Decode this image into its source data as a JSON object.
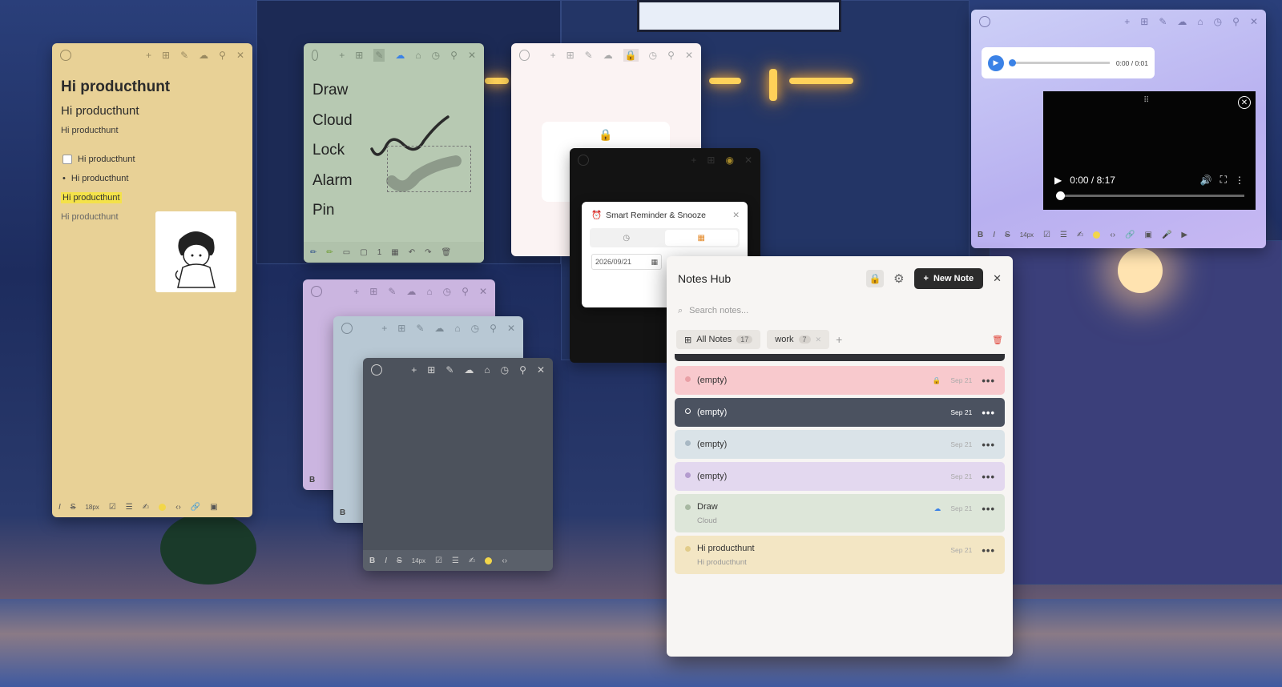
{
  "yellow_note": {
    "heading1": "Hi producthunt",
    "heading2": "Hi producthunt",
    "paragraph": "Hi producthunt",
    "checkbox_item": "Hi producthunt",
    "bullet_item": "Hi producthunt",
    "highlighted_text": "Hi producthunt",
    "plain_text": "Hi producthunt",
    "font_size": "18px",
    "footer_italic": "I",
    "footer_strike": "S"
  },
  "green_note": {
    "words": [
      "Draw",
      "Cloud",
      "Lock",
      "Alarm",
      "Pin"
    ],
    "page_count": "1"
  },
  "reminder": {
    "title": "Smart Reminder & Snooze",
    "date": "2026/09/21"
  },
  "purple_note": {
    "footer_bold": "B"
  },
  "bluegray_note": {
    "footer_bold": "B"
  },
  "dark_note": {
    "font_size": "14px",
    "bold": "B",
    "italic": "I",
    "strike": "S"
  },
  "media": {
    "audio_time": "0:00 / 0:01",
    "video_time": "0:00 / 8:17",
    "font_size": "14px",
    "bold": "B",
    "italic": "I",
    "strike": "S"
  },
  "hub": {
    "title": "Notes Hub",
    "new_note_label": "New Note",
    "search_placeholder": "Search notes...",
    "tabs": [
      {
        "label": "All Notes",
        "count": "17"
      },
      {
        "label": "work",
        "count": "7"
      }
    ],
    "items": [
      {
        "title": "(empty)",
        "subtitle": "",
        "date": "Sep 21",
        "bg": "#f8c9cd",
        "dot": "#e9a0a6",
        "locked": true,
        "dark": false
      },
      {
        "title": "(empty)",
        "subtitle": "",
        "date": "Sep 21",
        "bg": "#4b5260",
        "dot": "#ffffff",
        "locked": false,
        "dark": true
      },
      {
        "title": "(empty)",
        "subtitle": "",
        "date": "Sep 21",
        "bg": "#dae3e8",
        "dot": "#a8b8c4",
        "locked": false,
        "dark": false
      },
      {
        "title": "(empty)",
        "subtitle": "",
        "date": "Sep 21",
        "bg": "#e3d8ef",
        "dot": "#b49ccf",
        "locked": false,
        "dark": false
      },
      {
        "title": "Draw",
        "subtitle": "Cloud",
        "date": "Sep 21",
        "bg": "#dde6d9",
        "dot": "#a7b8a2",
        "locked": false,
        "dark": false,
        "cloud": true
      },
      {
        "title": "Hi producthunt",
        "subtitle": "Hi producthunt",
        "date": "Sep 21",
        "bg": "#f3e6c4",
        "dot": "#e2cc8a",
        "locked": false,
        "dark": false
      }
    ]
  },
  "colors": {
    "yellow": "#e8d196",
    "green": "#b7c9b2",
    "pink": "#fbf3f3",
    "purple": "#cbb5e0",
    "bluegray": "#b8c8d4",
    "darkgray": "#4c525c",
    "accent_blue": "#3b82e6",
    "alarm_orange": "#e48b2c"
  }
}
